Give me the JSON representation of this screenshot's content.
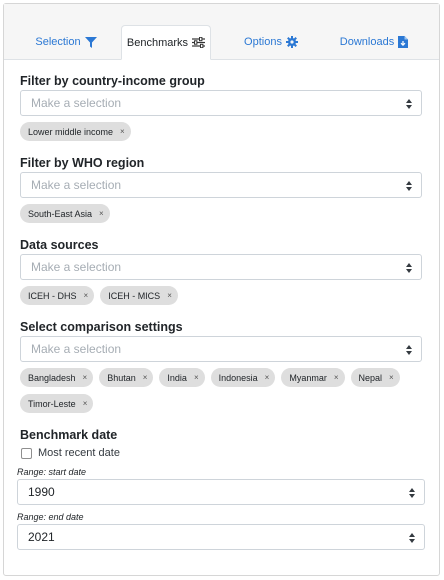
{
  "tabs": [
    {
      "label": "Selection",
      "icon": "filter-icon",
      "active": false
    },
    {
      "label": "Benchmarks",
      "icon": "sliders-icon",
      "active": true
    },
    {
      "label": "Options",
      "icon": "gear-icon",
      "active": false
    },
    {
      "label": "Downloads",
      "icon": "file-download-icon",
      "active": false
    }
  ],
  "filters": {
    "income": {
      "label": "Filter by country-income group",
      "placeholder": "Make a selection",
      "chips": [
        "Lower middle income"
      ]
    },
    "region": {
      "label": "Filter by WHO region",
      "placeholder": "Make a selection",
      "chips": [
        "South-East Asia"
      ]
    },
    "sources": {
      "label": "Data sources",
      "placeholder": "Make a selection",
      "chips": [
        "ICEH - DHS",
        "ICEH - MICS"
      ]
    },
    "comparison": {
      "label": "Select comparison settings",
      "placeholder": "Make a selection",
      "chips": [
        "Bangladesh",
        "Bhutan",
        "India",
        "Indonesia",
        "Myanmar",
        "Nepal",
        "Timor-Leste"
      ]
    }
  },
  "benchmark_date": {
    "label": "Benchmark date",
    "most_recent_label": "Most recent date",
    "most_recent_checked": false,
    "start_label": "Range: start date",
    "start_value": "1990",
    "end_label": "Range: end date",
    "end_value": "2021"
  },
  "chip_remove_glyph": "×",
  "colors": {
    "link": "#2b78d4",
    "chip_bg": "#dedede",
    "tabbar_bg": "#f6f6f6"
  }
}
